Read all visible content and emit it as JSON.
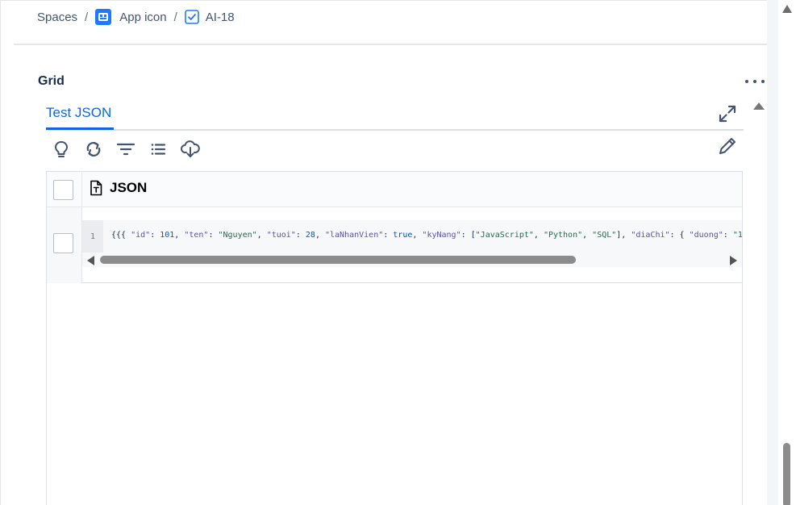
{
  "breadcrumb": {
    "spaces": "Spaces",
    "separator": "/",
    "app": "App icon",
    "issue": "AI-18"
  },
  "grid": {
    "title": "Grid"
  },
  "tabs": [
    {
      "label": "Test JSON",
      "active": true
    }
  ],
  "toolbar": {
    "icons": [
      "lightbulb-icon",
      "refresh-icon",
      "filter-icon",
      "list-icon",
      "cloud-download-icon"
    ]
  },
  "table": {
    "column_header": "JSON",
    "rows": [
      {
        "line_number": "1",
        "tokens": [
          {
            "t": "p",
            "v": "{{{ "
          },
          {
            "t": "k",
            "v": "\"id\""
          },
          {
            "t": "p",
            "v": ": "
          },
          {
            "t": "n",
            "v": "101"
          },
          {
            "t": "p",
            "v": ", "
          },
          {
            "t": "k",
            "v": "\"ten\""
          },
          {
            "t": "p",
            "v": ": "
          },
          {
            "t": "s",
            "v": "\"Nguyen\""
          },
          {
            "t": "p",
            "v": ", "
          },
          {
            "t": "k",
            "v": "\"tuoi\""
          },
          {
            "t": "p",
            "v": ": "
          },
          {
            "t": "n",
            "v": "28"
          },
          {
            "t": "p",
            "v": ", "
          },
          {
            "t": "k",
            "v": "\"laNhanVien\""
          },
          {
            "t": "p",
            "v": ": "
          },
          {
            "t": "b",
            "v": "true"
          },
          {
            "t": "p",
            "v": ", "
          },
          {
            "t": "k",
            "v": "\"kyNang\""
          },
          {
            "t": "p",
            "v": ": ["
          },
          {
            "t": "s",
            "v": "\"JavaScript\""
          },
          {
            "t": "p",
            "v": ", "
          },
          {
            "t": "s",
            "v": "\"Python\""
          },
          {
            "t": "p",
            "v": ", "
          },
          {
            "t": "s",
            "v": "\"SQL\""
          },
          {
            "t": "p",
            "v": "], "
          },
          {
            "t": "k",
            "v": "\"diaChi\""
          },
          {
            "t": "p",
            "v": ": { "
          },
          {
            "t": "k",
            "v": "\"duong\""
          },
          {
            "t": "p",
            "v": ": "
          },
          {
            "t": "s",
            "v": "\"1"
          }
        ]
      }
    ]
  },
  "colors": {
    "accent": "#0c66e4",
    "app_icon_bg": "#1d7afc",
    "issue_icon": "#1d7afc"
  }
}
